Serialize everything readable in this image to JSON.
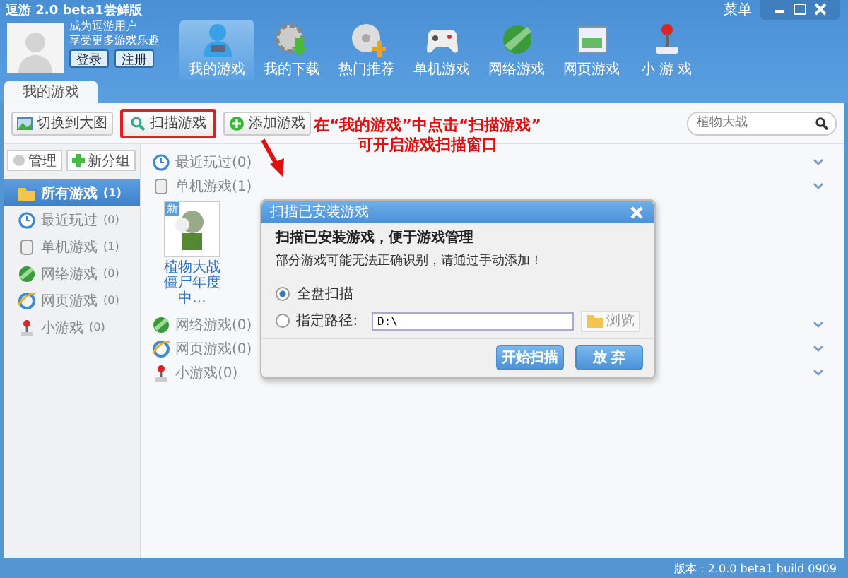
{
  "window": {
    "title": "逗游 2.0 beta1尝鲜版",
    "menu": "菜单"
  },
  "user": {
    "line1": "成为逗游用户",
    "line2": "享受更多游戏乐趣",
    "buttons": [
      "登录",
      "注册"
    ]
  },
  "nav": [
    {
      "label": "我的游戏",
      "selected": true
    },
    {
      "label": "我的下载",
      "selected": false
    },
    {
      "label": "热门推荐",
      "selected": false
    },
    {
      "label": "单机游戏",
      "selected": false
    },
    {
      "label": "网络游戏",
      "selected": false
    },
    {
      "label": "网页游戏",
      "selected": false
    },
    {
      "label": "小 游 戏",
      "selected": false
    }
  ],
  "tabs": [
    {
      "label": "我的游戏",
      "selected": true
    }
  ],
  "toolbar": {
    "buttons": [
      {
        "label": "切换到大图",
        "highlighted": false
      },
      {
        "label": "扫描游戏",
        "highlighted": true
      },
      {
        "label": "添加游戏",
        "highlighted": false
      }
    ],
    "search": {
      "placeholder": "植物大战"
    }
  },
  "annotation": [
    "在“我的游戏”中点击“扫描游戏”",
    "可开启游戏扫描窗口"
  ],
  "sidebar": {
    "buttons": [
      "管理",
      "新分组"
    ],
    "items": [
      {
        "label": "所有游戏",
        "count": "(1)",
        "kind": "folder",
        "selected": true
      },
      {
        "label": "最近玩过",
        "count": "(0)",
        "kind": "recent",
        "selected": false
      },
      {
        "label": "单机游戏",
        "count": "(1)",
        "kind": "pc",
        "selected": false
      },
      {
        "label": "网络游戏",
        "count": "(0)",
        "kind": "online",
        "selected": false
      },
      {
        "label": "网页游戏",
        "count": "(0)",
        "kind": "web",
        "selected": false
      },
      {
        "label": "小游戏",
        "count": "(0)",
        "kind": "mini",
        "selected": false
      }
    ]
  },
  "sections": [
    {
      "label": "最近玩过(0)",
      "kind": "recent"
    },
    {
      "label": "单机游戏(1)",
      "kind": "pc",
      "games": [
        {
          "title": "植物大战僵尸年度中...",
          "badge": "新"
        }
      ]
    },
    {
      "label": "网络游戏(0)",
      "kind": "online"
    },
    {
      "label": "网页游戏(0)",
      "kind": "web"
    },
    {
      "label": "小游戏(0)",
      "kind": "mini"
    }
  ],
  "dialog": {
    "title": "扫描已安装游戏",
    "heading": "扫描已安装游戏，便于游戏管理",
    "note": "部分游戏可能无法正确识别，请通过手动添加！",
    "options": [
      {
        "label": "全盘扫描",
        "selected": true
      },
      {
        "label": "指定路径:",
        "selected": false,
        "path": "D:\\",
        "browse": "浏览"
      }
    ],
    "buttons": [
      "开始扫描",
      "放 弃"
    ]
  },
  "status_bar": "版本：2.0.0 beta1 build 0909"
}
